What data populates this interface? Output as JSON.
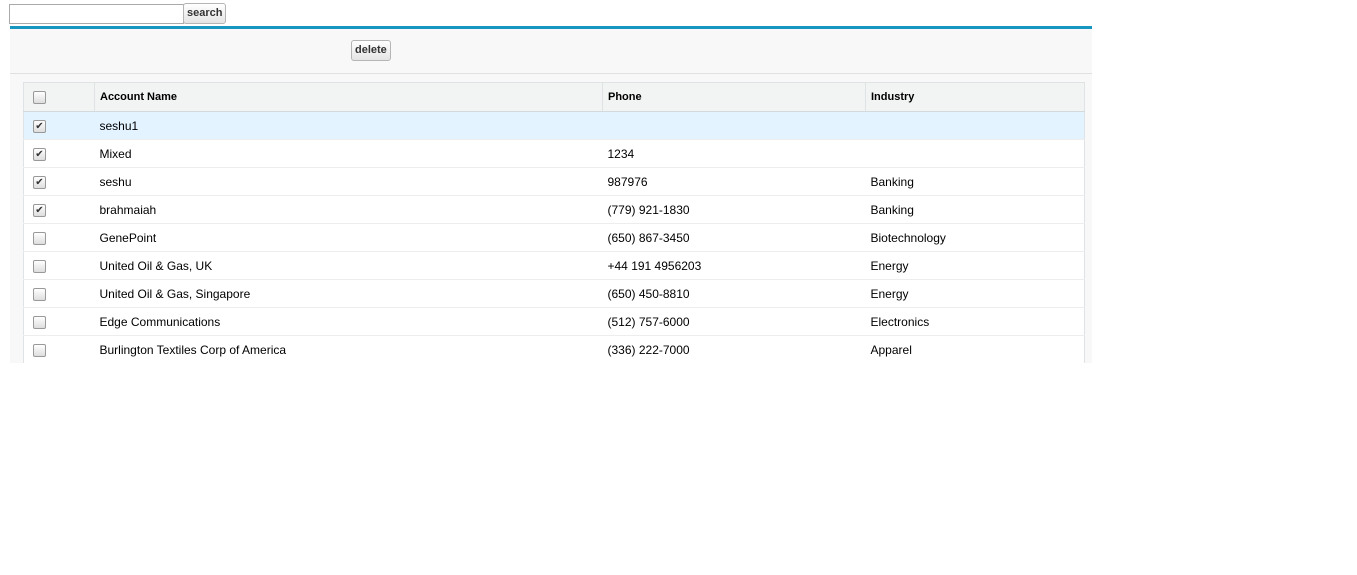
{
  "search": {
    "value": "",
    "button": "search"
  },
  "toolbar": {
    "delete": "delete"
  },
  "table": {
    "headers": [
      "Account Name",
      "Phone",
      "Industry"
    ],
    "rows": [
      {
        "checked": true,
        "name": "seshu1",
        "phone": "",
        "industry": ""
      },
      {
        "checked": true,
        "name": "Mixed",
        "phone": "1234",
        "industry": ""
      },
      {
        "checked": true,
        "name": "seshu",
        "phone": "987976",
        "industry": "Banking"
      },
      {
        "checked": true,
        "name": "brahmaiah",
        "phone": "(779) 921-1830",
        "industry": "Banking"
      },
      {
        "checked": false,
        "name": "GenePoint",
        "phone": "(650) 867-3450",
        "industry": "Biotechnology"
      },
      {
        "checked": false,
        "name": "United Oil & Gas, UK",
        "phone": "+44 191 4956203",
        "industry": "Energy"
      },
      {
        "checked": false,
        "name": "United Oil & Gas, Singapore",
        "phone": "(650) 450-8810",
        "industry": "Energy"
      },
      {
        "checked": false,
        "name": "Edge Communications",
        "phone": "(512) 757-6000",
        "industry": "Electronics"
      },
      {
        "checked": false,
        "name": "Burlington Textiles Corp of America",
        "phone": "(336) 222-7000",
        "industry": "Apparel"
      }
    ]
  }
}
